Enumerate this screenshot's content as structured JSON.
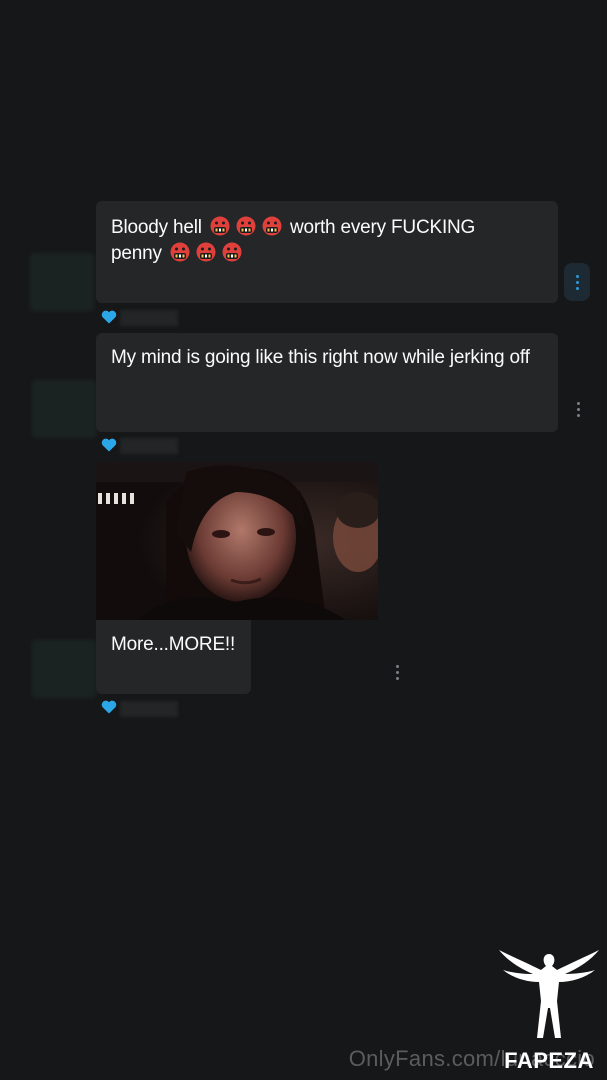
{
  "messages": [
    {
      "text_before": "Bloody hell",
      "text_middle": "worth every FUCKING",
      "text_line2": "penny",
      "emoji_name": "face-with-symbols-on-mouth-emoji",
      "liked": true
    },
    {
      "text": "My mind is going like this right now while jerking off",
      "liked": true
    },
    {
      "media": "gif-kylo-ren",
      "text": "More...MORE!!",
      "liked": true
    }
  ],
  "watermark": {
    "site": "OnlyFans.com/lunac",
    "site_tail": "ccio",
    "logo_text": "FAPEZA"
  },
  "colors": {
    "background": "#161718",
    "bubble": "#242628",
    "heart": "#2ba7e8",
    "accent": "#2d9ad8"
  }
}
